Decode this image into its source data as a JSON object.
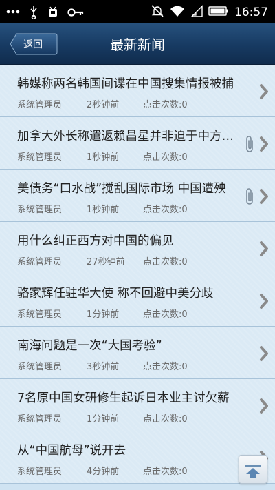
{
  "status_bar": {
    "time": "16:57",
    "left_icons": [
      "more-dots-icon",
      "usb-icon",
      "android-debug-icon",
      "key-icon"
    ],
    "right_icons": [
      "mute-icon",
      "wifi-icon",
      "signal-icon",
      "battery-icon"
    ]
  },
  "header": {
    "back_label": "返回",
    "title": "最新新闻",
    "colors": {
      "bar_top": "#27527e",
      "bar_bottom": "#102c4d"
    }
  },
  "news": [
    {
      "title": "韩媒称两名韩国间谍在中国搜集情报被捕",
      "author": "系统管理员",
      "time": "2秒钟前",
      "clicks": "点击次数:0",
      "attachment": false
    },
    {
      "title": "加拿大外长称遣返赖昌星并非迫于中方压力",
      "author": "系统管理员",
      "time": "1秒钟前",
      "clicks": "点击次数:0",
      "attachment": true
    },
    {
      "title": "美债务“口水战”搅乱国际市场 中国遭殃",
      "author": "系统管理员",
      "time": "1秒钟前",
      "clicks": "点击次数:0",
      "attachment": true
    },
    {
      "title": "用什么纠正西方对中国的偏见",
      "author": "系统管理员",
      "time": "27秒钟前",
      "clicks": "点击次数:0",
      "attachment": false
    },
    {
      "title": "骆家辉任驻华大使 称不回避中美分歧",
      "author": "系统管理员",
      "time": "1分钟前",
      "clicks": "点击次数:0",
      "attachment": false
    },
    {
      "title": "南海问题是一次“大国考验”",
      "author": "系统管理员",
      "time": "3秒钟前",
      "clicks": "点击次数:0",
      "attachment": false
    },
    {
      "title": "7名原中国女研修生起诉日本业主讨欠薪",
      "author": "系统管理员",
      "time": "1分钟前",
      "clicks": "点击次数:0",
      "attachment": false
    },
    {
      "title": "从“中国航母”说开去",
      "author": "系统管理员",
      "time": "4分钟前",
      "clicks": "点击次数:0",
      "attachment": false
    }
  ],
  "scroll_top_icon": "arrow-up-icon"
}
